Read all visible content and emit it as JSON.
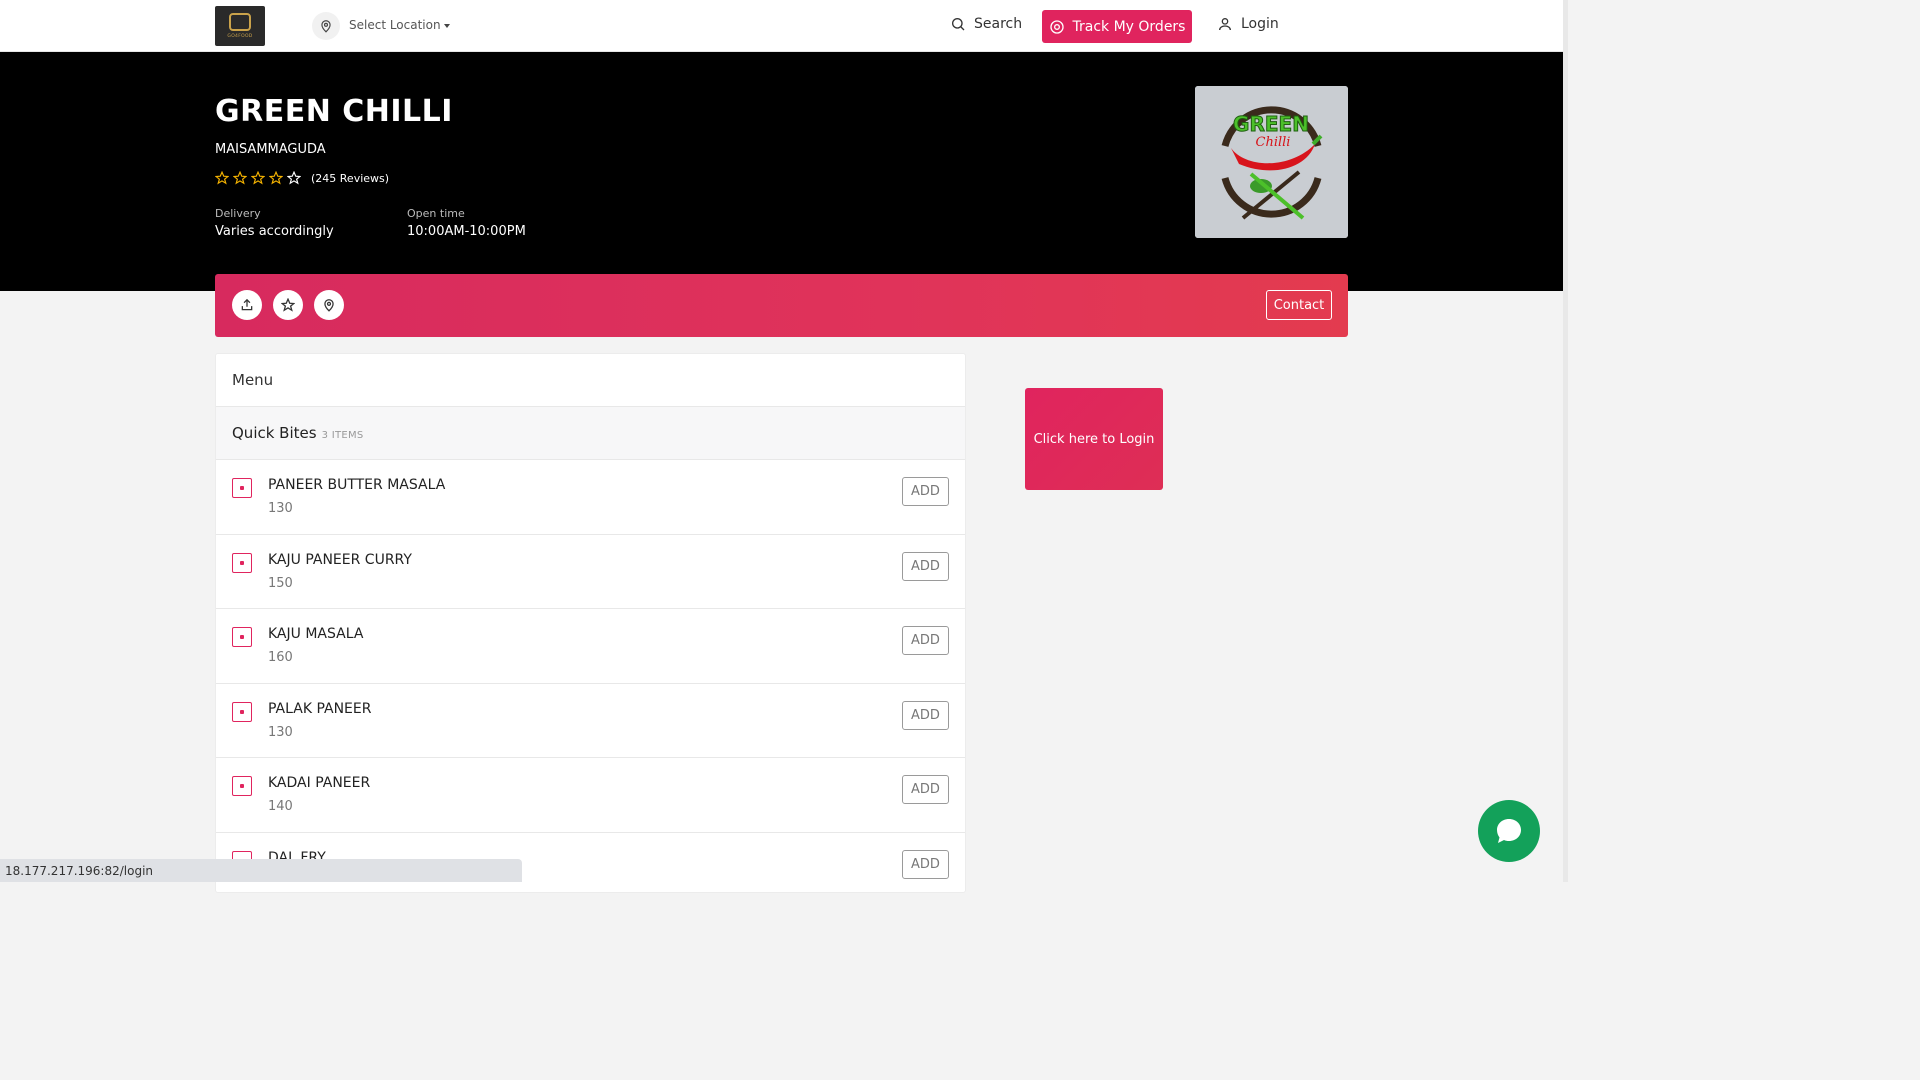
{
  "nav": {
    "logo_text": "GO4FOOD",
    "location_label": "Select Location",
    "search_label": "Search",
    "track_label": "Track My Orders",
    "login_label": "Login"
  },
  "restaurant": {
    "name": "GREEN CHILLI",
    "area": "MAISAMMAGUDA",
    "reviews": "(245 Reviews)",
    "delivery_label": "Delivery",
    "delivery_value": "Varies accordingly",
    "open_label": "Open time",
    "open_value": "10:00AM-10:00PM",
    "logo_title": "GREEN",
    "logo_sub": "Chilli"
  },
  "actions": {
    "contact_label": "Contact"
  },
  "menu": {
    "title": "Menu",
    "category": "Quick Bites",
    "category_count": "3 ITEMS",
    "add_label": "ADD",
    "items": [
      {
        "name": "PANEER BUTTER MASALA",
        "price": "130"
      },
      {
        "name": "KAJU PANEER CURRY",
        "price": "150"
      },
      {
        "name": "KAJU MASALA",
        "price": "160"
      },
      {
        "name": "PALAK PANEER",
        "price": "130"
      },
      {
        "name": "KADAI PANEER",
        "price": "140"
      },
      {
        "name": "DAL FRY",
        "price": ""
      }
    ]
  },
  "sidebar": {
    "login_tile": "Click here to Login"
  },
  "status": {
    "url": "18.177.217.196:82/login"
  },
  "colors": {
    "accent": "#e0245e",
    "hero_bg": "#000000",
    "chat": "#13a15a"
  }
}
